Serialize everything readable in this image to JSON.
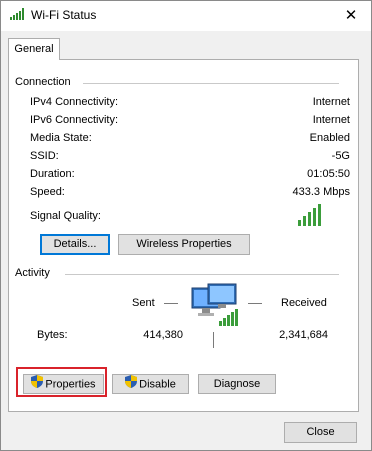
{
  "window": {
    "title": "Wi-Fi Status",
    "close_glyph": "✕",
    "icon": "wifi-signal-icon"
  },
  "tabs": [
    {
      "label": "General"
    }
  ],
  "connection": {
    "group_label": "Connection",
    "rows": [
      {
        "label": "IPv4 Connectivity:",
        "value": "Internet"
      },
      {
        "label": "IPv6 Connectivity:",
        "value": "Internet"
      },
      {
        "label": "Media State:",
        "value": "Enabled"
      },
      {
        "label": "SSID:",
        "value": "-5G"
      },
      {
        "label": "Duration:",
        "value": "01:05:50"
      },
      {
        "label": "Speed:",
        "value": "433.3 Mbps"
      }
    ],
    "signal_label": "Signal Quality:",
    "signal_icon": "signal-strength-icon",
    "details_button": "Details...",
    "wireless_button": "Wireless Properties"
  },
  "activity": {
    "group_label": "Activity",
    "sent_label": "Sent",
    "received_label": "Received",
    "bytes_label": "Bytes:",
    "bytes_sent": "414,380",
    "bytes_received": "2,341,684",
    "icon": "network-computer-icon"
  },
  "bottom_buttons": {
    "properties": "Properties",
    "disable": "Disable",
    "diagnose": "Diagnose"
  },
  "footer": {
    "close_button": "Close"
  },
  "colors": {
    "highlight": "#d9232b",
    "focus": "#0078d7",
    "signal": "#3b9d3b"
  }
}
